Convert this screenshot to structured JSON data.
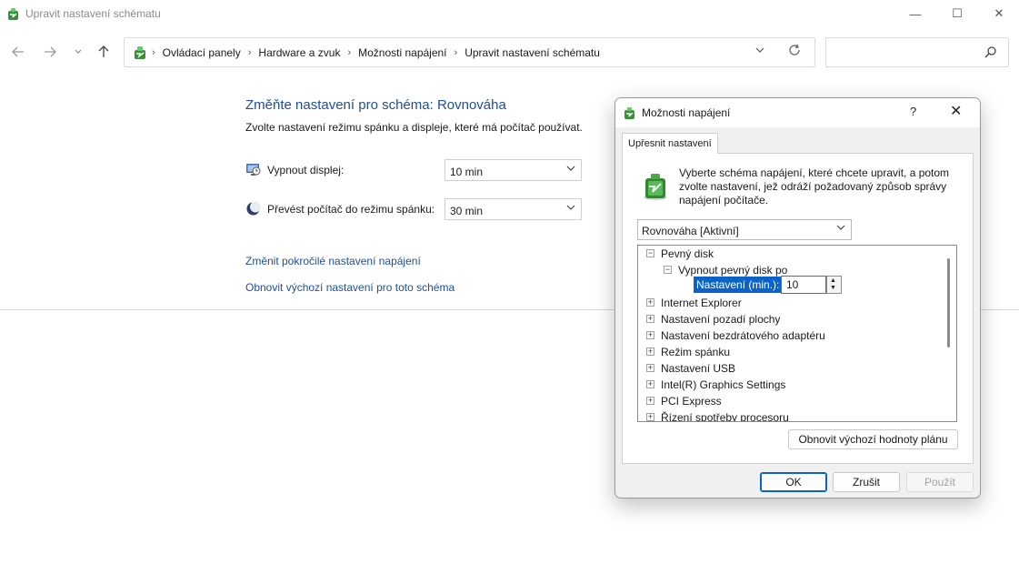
{
  "window": {
    "title": "Upravit nastavení schématu",
    "controls": {
      "minimize": "—",
      "maximize": "☐",
      "close": "✕"
    }
  },
  "nav": {
    "back_icon": "arrow-left",
    "forward_icon": "arrow-right",
    "recent_icon": "chevron-down",
    "up_icon": "arrow-up",
    "breadcrumbs": [
      "Ovládací panely",
      "Hardware a zvuk",
      "Možnosti napájení",
      "Upravit nastavení schématu"
    ],
    "search_placeholder": ""
  },
  "page": {
    "title": "Změňte nastavení pro schéma: Rovnováha",
    "subtitle": "Zvolte nastavení režimu spánku a displeje, které má počítač používat.",
    "settings": [
      {
        "label": "Vypnout displej:",
        "value": "10 min",
        "icon": "monitor-icon"
      },
      {
        "label": "Převést počítač do režimu spánku:",
        "value": "30 min",
        "icon": "moon-icon"
      }
    ],
    "links": {
      "advanced": "Změnit pokročilé nastavení napájení",
      "restore": "Obnovit výchozí nastavení pro toto schéma"
    }
  },
  "dialog": {
    "title": "Možnosti napájení",
    "help": "?",
    "close": "✕",
    "tab": "Upřesnit nastavení",
    "intro": "Vyberte schéma napájení, které chcete upravit, a potom zvolte nastavení, jež odráží požadovaný způsob správy napájení počítače.",
    "plan": "Rovnováha [Aktivní]",
    "tree": {
      "expanded_node": "Pevný disk",
      "child_node": "Vypnout pevný disk po",
      "setting_label": "Nastavení (min.):",
      "setting_value": "10",
      "items": [
        "Internet Explorer",
        "Nastavení pozadí plochy",
        "Nastavení bezdrátového adaptéru",
        "Režim spánku",
        "Nastavení USB",
        "Intel(R) Graphics Settings",
        "PCI Express",
        "Řízení spotřeby procesoru"
      ]
    },
    "buttons": {
      "restore": "Obnovit výchozí hodnoty plánu",
      "ok": "OK",
      "cancel": "Zrušit",
      "apply": "Použít"
    }
  },
  "colors": {
    "link": "#1e4e9c",
    "selection": "#0a63c9",
    "dialog_bg": "#f0f0f0"
  }
}
